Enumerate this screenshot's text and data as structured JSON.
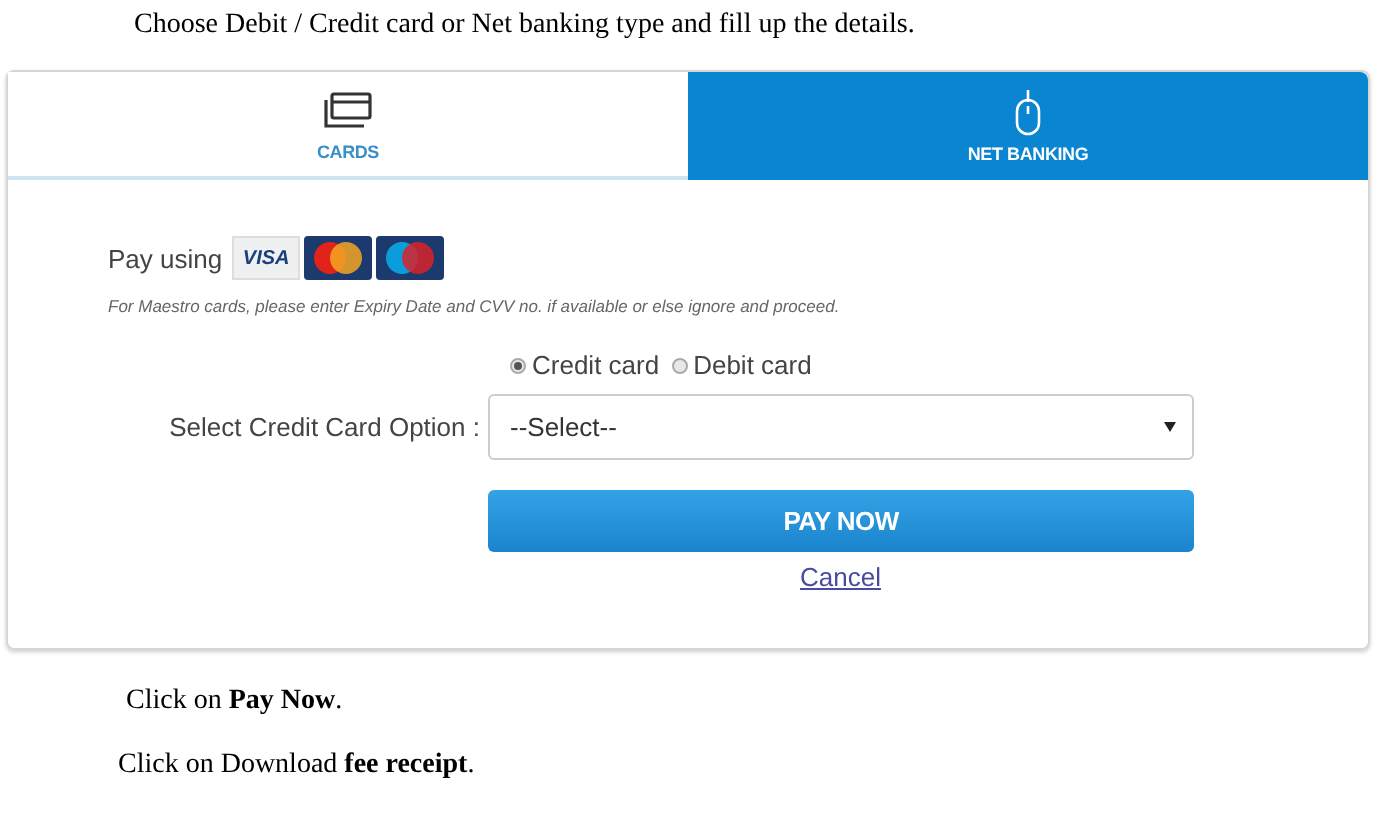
{
  "intro": "Choose Debit / Credit card or Net banking type and fill up the details.",
  "tabs": [
    {
      "label": "CARDS",
      "kind": "card",
      "selected": true
    },
    {
      "label": "NET BANKING",
      "kind": "mouse",
      "selected": false
    }
  ],
  "pay_using": {
    "label": "Pay using",
    "visa": "VISA"
  },
  "note": "For Maestro cards, please enter Expiry Date and CVV no. if available or else ignore and proceed.",
  "card_types": [
    {
      "label": "Credit card",
      "selected": true
    },
    {
      "label": "Debit card",
      "selected": false
    }
  ],
  "option_label": "Select Credit Card Option :",
  "option_select": {
    "value": "--Select--"
  },
  "pay_button": "PAY NOW",
  "cancel_link": "Cancel",
  "steps": [
    "Click on **Pay Now**.",
    "Click on Download **fee receipt**."
  ]
}
